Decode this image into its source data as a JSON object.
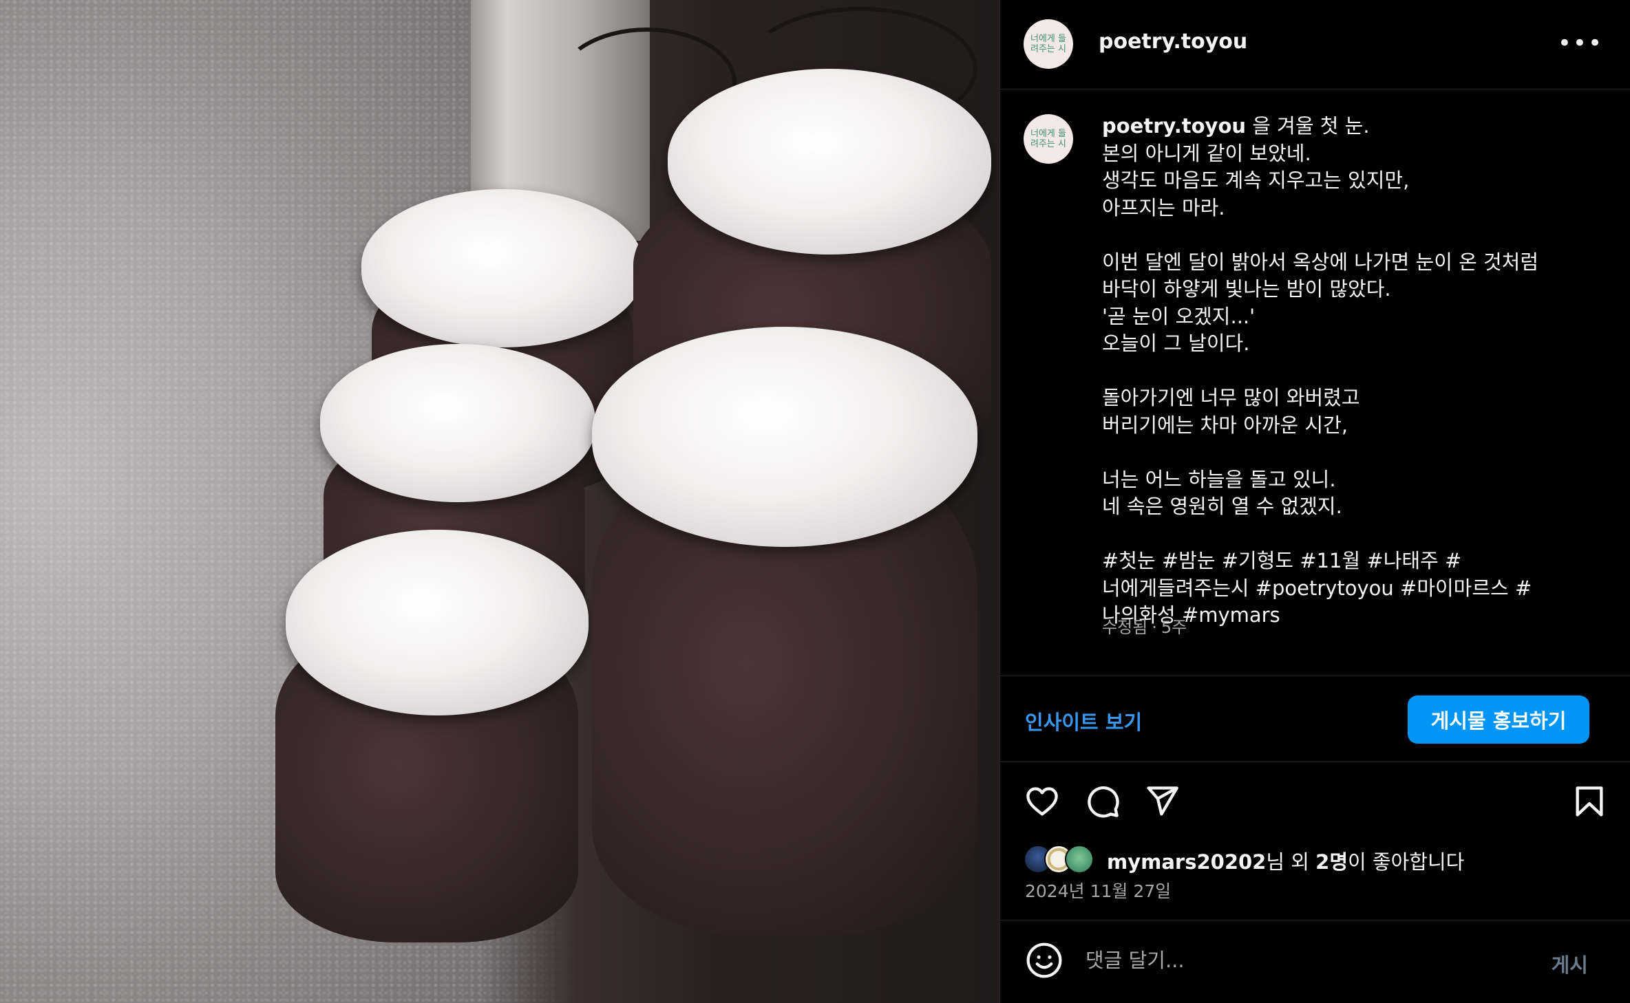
{
  "post": {
    "username": "poetry.toyou",
    "avatar_text": "너에게\n들려주는\n시",
    "more_glyph": "•••",
    "caption_lines": [
      "을 겨울 첫 눈.",
      "본의 아니게 같이 보았네.",
      "생각도 마음도 계속 지우고는 있지만,",
      "아프지는 마라.",
      "",
      "이번 달엔 달이 밝아서 옥상에 나가면 눈이 온 것처럼 바닥이 하얗게 빛나는 밤이 많았다.",
      "'곧 눈이 오겠지...'",
      "오늘이 그 날이다.",
      "",
      "돌아가기엔 너무 많이 와버렸고",
      "버리기에는 차마 아까운 시간,",
      "",
      "너는 어느 하늘을 돌고 있니.",
      "네 속은 영원히 열 수 없겠지.",
      "",
      "#첫눈 #밤눈 #기형도 #11월 #나태주 #너에게들려주는시 #poetrytoyou #마이마르스 #나의화성 #mymars"
    ],
    "edited_label": "수정됨",
    "separator": "·",
    "age_label": "5주"
  },
  "actions": {
    "insights_label": "인사이트 보기",
    "promote_label": "게시물 홍보하기"
  },
  "icons": [
    "heart-icon",
    "comment-icon",
    "share-icon",
    "bookmark-icon"
  ],
  "likes": {
    "liker": "mymars20202",
    "suffix_1": "님 외 ",
    "others": "2명",
    "suffix_2": "이 좋아합니다",
    "date": "2024년 11월 27일"
  },
  "comment": {
    "placeholder": "댓글 달기...",
    "post_label": "게시"
  },
  "colors": {
    "accent": "#0095f6",
    "link": "#3897f0",
    "avatar_ink": "#3f8f6f"
  }
}
